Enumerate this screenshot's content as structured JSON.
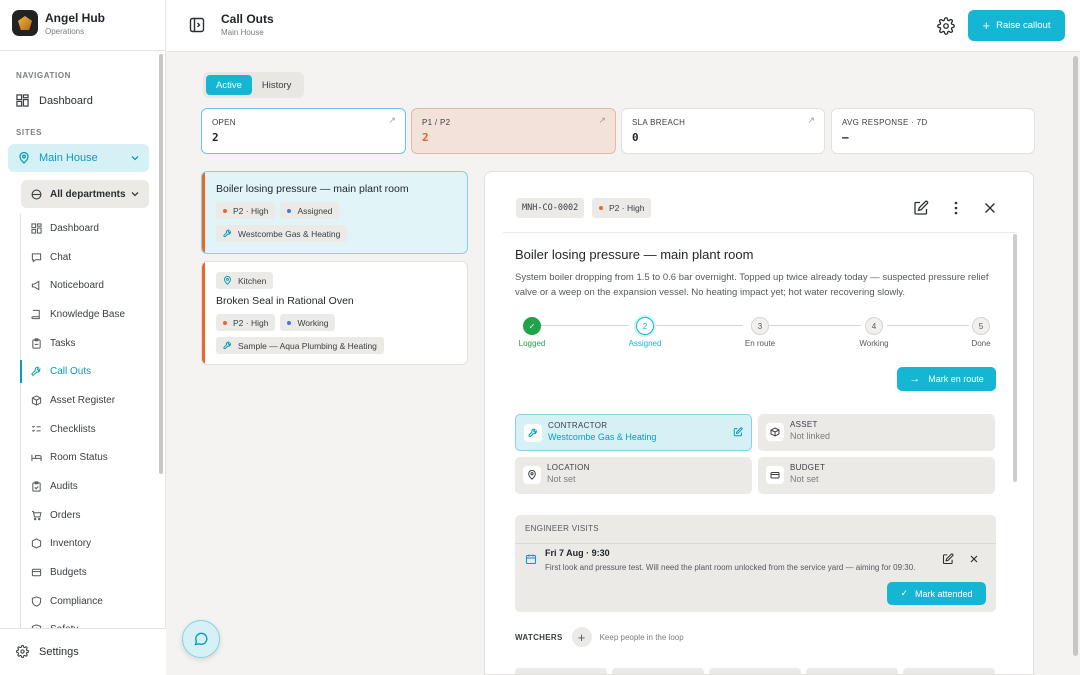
{
  "brand": {
    "title": "Angel Hub",
    "subtitle": "Operations"
  },
  "sidebar": {
    "nav_label": "NAVIGATION",
    "dashboard": "Dashboard",
    "sites_label": "SITES",
    "site": "Main House",
    "department": "All departments",
    "items": [
      {
        "label": "Dashboard",
        "icon": "grid-icon"
      },
      {
        "label": "Chat",
        "icon": "chat-icon"
      },
      {
        "label": "Noticeboard",
        "icon": "megaphone-icon"
      },
      {
        "label": "Knowledge Base",
        "icon": "book-icon"
      },
      {
        "label": "Tasks",
        "icon": "clipboard-icon"
      },
      {
        "label": "Call Outs",
        "icon": "wrench-icon",
        "active": true
      },
      {
        "label": "Asset Register",
        "icon": "box-icon"
      },
      {
        "label": "Checklists",
        "icon": "checklist-icon"
      },
      {
        "label": "Room Status",
        "icon": "bed-icon"
      },
      {
        "label": "Audits",
        "icon": "clipboard-check-icon"
      },
      {
        "label": "Orders",
        "icon": "cart-icon"
      },
      {
        "label": "Inventory",
        "icon": "package-icon"
      },
      {
        "label": "Budgets",
        "icon": "wallet-icon"
      },
      {
        "label": "Compliance",
        "icon": "shield-icon"
      },
      {
        "label": "Safety",
        "icon": "shield-alert-icon"
      }
    ],
    "settings": "Settings"
  },
  "header": {
    "title": "Call Outs",
    "subtitle": "Main House",
    "raise_label": "Raise callout"
  },
  "tabs": {
    "active": "Active",
    "history": "History"
  },
  "stats": [
    {
      "label": "OPEN",
      "value": "2"
    },
    {
      "label": "P1 / P2",
      "value": "2"
    },
    {
      "label": "SLA BREACH",
      "value": "0"
    },
    {
      "label": "AVG RESPONSE · 7D",
      "value": "—"
    }
  ],
  "cards": [
    {
      "title": "Boiler losing pressure — main plant room",
      "priority": "P2 · High",
      "status": "Assigned",
      "contractor": "Westcombe Gas & Heating"
    },
    {
      "location": "Kitchen",
      "title": "Broken Seal in Rational Oven",
      "priority": "P2 · High",
      "status": "Working",
      "contractor": "Sample — Aqua Plumbing & Heating"
    }
  ],
  "detail": {
    "code": "MNH-CO-0002",
    "priority": "P2 · High",
    "title": "Boiler losing pressure — main plant room",
    "description": "System boiler dropping from 1.5 to 0.6 bar overnight. Topped up twice already today — suspected pressure relief valve or a weep on the expansion vessel. No heating impact yet; hot water recovering slowly.",
    "steps": [
      {
        "num": "1",
        "label": "Logged",
        "state": "done"
      },
      {
        "num": "2",
        "label": "Assigned",
        "state": "current"
      },
      {
        "num": "3",
        "label": "En route",
        "state": "todo"
      },
      {
        "num": "4",
        "label": "Working",
        "state": "todo"
      },
      {
        "num": "5",
        "label": "Done",
        "state": "todo"
      }
    ],
    "enroute_label": "Mark en route",
    "contractor_label": "CONTRACTOR",
    "contractor_value": "Westcombe Gas & Heating",
    "asset_label": "ASSET",
    "asset_value": "Not linked",
    "location_label": "LOCATION",
    "location_value": "Not set",
    "budget_label": "BUDGET",
    "budget_value": "Not set",
    "visits_label": "ENGINEER VISITS",
    "visit_date": "Fri 7 Aug · 9:30",
    "visit_note": "First look and pressure test. Will need the plant room unlocked from the service yard — aiming for 09:30.",
    "attended_label": "Mark attended",
    "watchers_label": "WATCHERS",
    "watchers_hint": "Keep people in the loop"
  },
  "colors": {
    "accent": "#14b6d4",
    "priority": "#e46a2a",
    "done": "#21a34a"
  }
}
